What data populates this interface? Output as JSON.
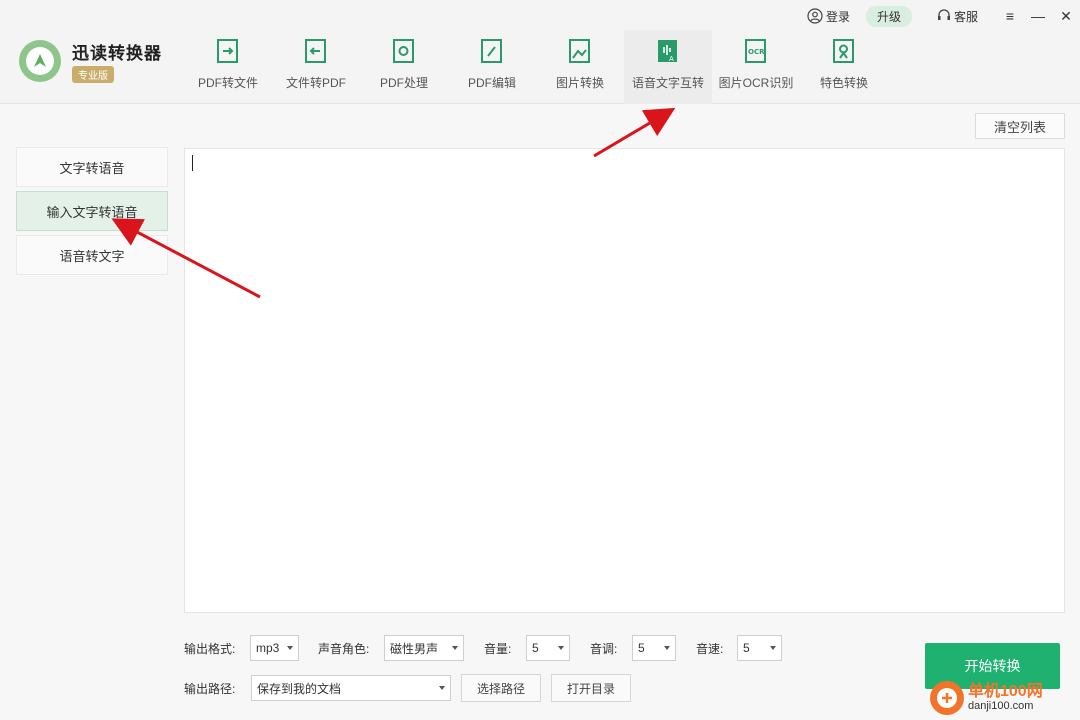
{
  "app": {
    "name": "迅读转换器",
    "edition": "专业版"
  },
  "top_actions": {
    "login": "登录",
    "upgrade": "升级",
    "service": "客服",
    "menu_icon": "≡",
    "minimize_icon": "—",
    "close_icon": "✕"
  },
  "toolbar": [
    {
      "label": "PDF转文件",
      "icon": "pdf-export-icon"
    },
    {
      "label": "文件转PDF",
      "icon": "file-to-pdf-icon"
    },
    {
      "label": "PDF处理",
      "icon": "pdf-process-icon"
    },
    {
      "label": "PDF编辑",
      "icon": "pdf-edit-icon"
    },
    {
      "label": "图片转换",
      "icon": "image-convert-icon"
    },
    {
      "label": "语音文字互转",
      "icon": "voice-text-icon",
      "active": true
    },
    {
      "label": "图片OCR识别",
      "icon": "ocr-icon"
    },
    {
      "label": "特色转换",
      "icon": "special-convert-icon"
    }
  ],
  "sidebar": [
    {
      "label": "文字转语音"
    },
    {
      "label": "输入文字转语音",
      "active": true
    },
    {
      "label": "语音转文字"
    }
  ],
  "main": {
    "clear_list": "清空列表",
    "text_value": ""
  },
  "controls": {
    "format_label": "输出格式:",
    "format_value": "mp3",
    "voice_label": "声音角色:",
    "voice_value": "磁性男声",
    "volume_label": "音量:",
    "volume_value": "5",
    "pitch_label": "音调:",
    "pitch_value": "5",
    "speed_label": "音速:",
    "speed_value": "5",
    "path_label": "输出路径:",
    "path_value": "保存到我的文档",
    "choose_path": "选择路径",
    "open_dir": "打开目录",
    "start": "开始转换"
  },
  "watermark": {
    "cn": "单机100网",
    "url": "danji100.com"
  },
  "colors": {
    "accent": "#1eb16f",
    "icon_green": "#2a9a6a",
    "annotation_red": "#d9141a",
    "edition_gold": "#c9ad6b"
  }
}
